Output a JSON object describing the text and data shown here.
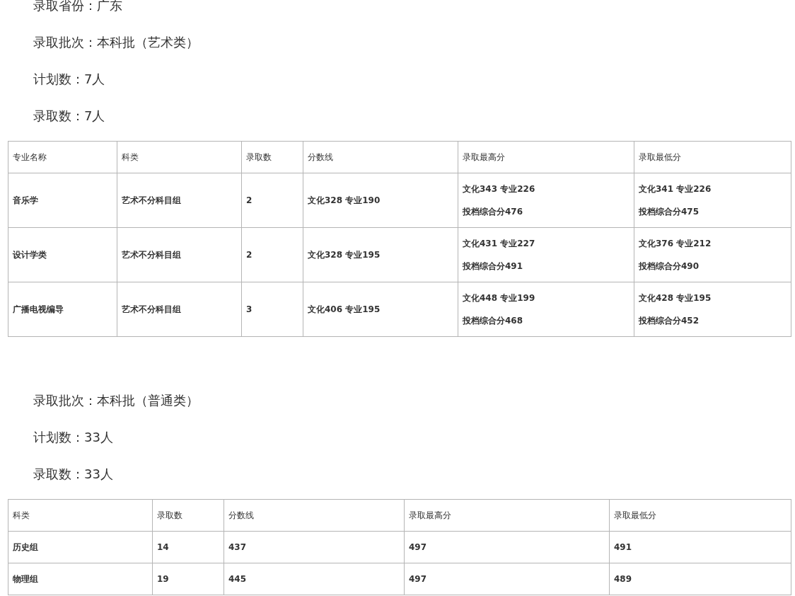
{
  "sections": [
    {
      "paragraphs": [
        "录取省份：广东",
        "录取批次：本科批（艺术类）",
        "计划数：7人",
        "录取数：7人"
      ],
      "table": {
        "columns": [
          "专业名称",
          "科类",
          "录取数",
          "分数线",
          "录取最高分",
          "录取最低分"
        ],
        "rows": [
          [
            [
              "音乐学"
            ],
            [
              "艺术不分科目组"
            ],
            [
              "2"
            ],
            [
              "文化328 专业190"
            ],
            [
              "文化343 专业226",
              "投档综合分476"
            ],
            [
              "文化341 专业226",
              "投档综合分475"
            ]
          ],
          [
            [
              "设计学类"
            ],
            [
              "艺术不分科目组"
            ],
            [
              "2"
            ],
            [
              "文化328 专业195"
            ],
            [
              "文化431 专业227",
              "投档综合分491"
            ],
            [
              "文化376 专业212",
              "投档综合分490"
            ]
          ],
          [
            [
              "广播电视编导"
            ],
            [
              "艺术不分科目组"
            ],
            [
              "3"
            ],
            [
              "文化406 专业195"
            ],
            [
              "文化448 专业199",
              "投档综合分468"
            ],
            [
              "文化428 专业195",
              "投档综合分452"
            ]
          ]
        ]
      }
    },
    {
      "paragraphs": [
        "录取批次：本科批（普通类）",
        "计划数：33人",
        "录取数：33人"
      ],
      "table": {
        "columns": [
          "科类",
          "录取数",
          "分数线",
          "录取最高分",
          "录取最低分"
        ],
        "rows": [
          [
            [
              "历史组"
            ],
            [
              "14"
            ],
            [
              "437"
            ],
            [
              "497"
            ],
            [
              "491"
            ]
          ],
          [
            [
              "物理组"
            ],
            [
              "19"
            ],
            [
              "445"
            ],
            [
              "497"
            ],
            [
              "489"
            ]
          ]
        ]
      }
    }
  ]
}
